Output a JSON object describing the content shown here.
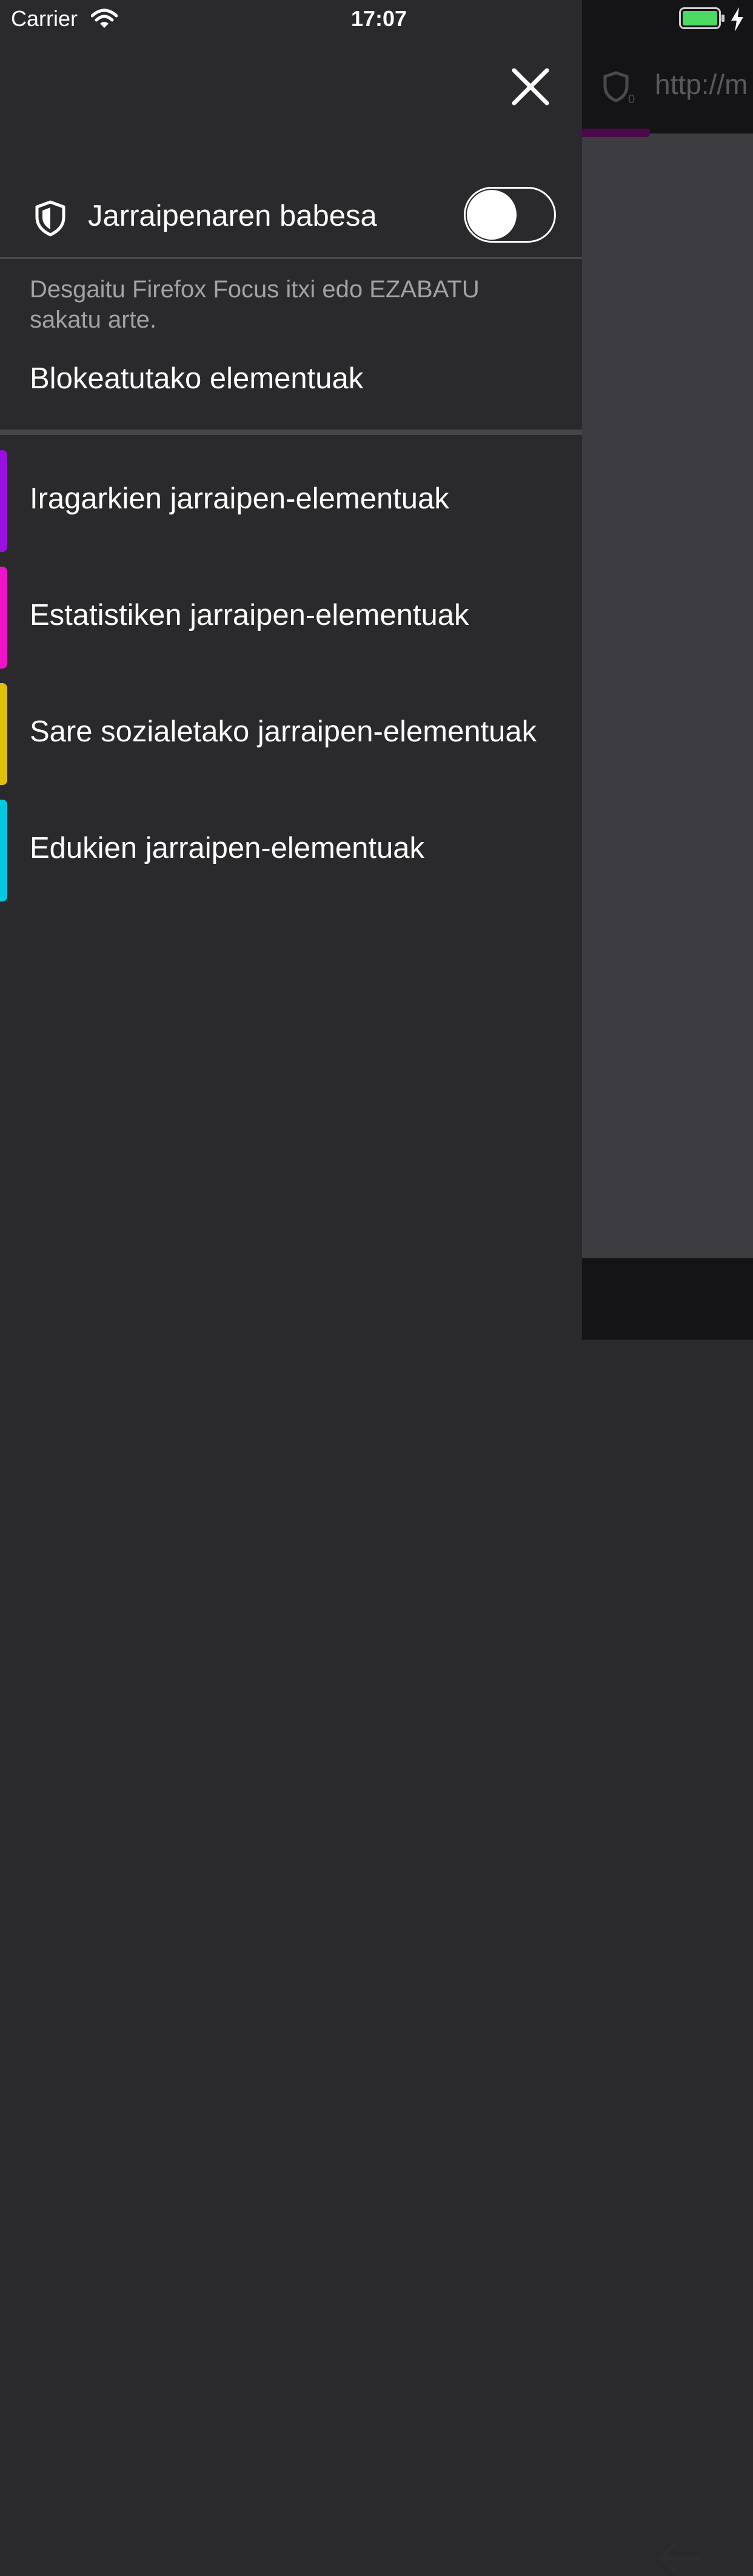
{
  "status_bar": {
    "carrier": "Carrier",
    "time": "17:07",
    "battery_color": "#4cd964"
  },
  "background_browser": {
    "url_text": "http://m",
    "shield_count": "0"
  },
  "panel": {
    "close_icon": "close-icon",
    "tracking_protection": {
      "label": "Jarraipenaren babesa",
      "enabled": false,
      "description": "Desgaitu Firefox Focus itxi edo EZABATU sakatu arte."
    },
    "blocked_title": "Blokeatutako elementuak",
    "trackers": [
      {
        "label": "Iragarkien jarraipen-elementuak",
        "color": "#9a0fe2"
      },
      {
        "label": "Estatistiken jarraipen-elementuak",
        "color": "#f012c8"
      },
      {
        "label": "Sare sozialetako jarraipen-elementuak",
        "color": "#e0c00c"
      },
      {
        "label": "Edukien jarraipen-elementuak",
        "color": "#02c8e0"
      }
    ]
  }
}
